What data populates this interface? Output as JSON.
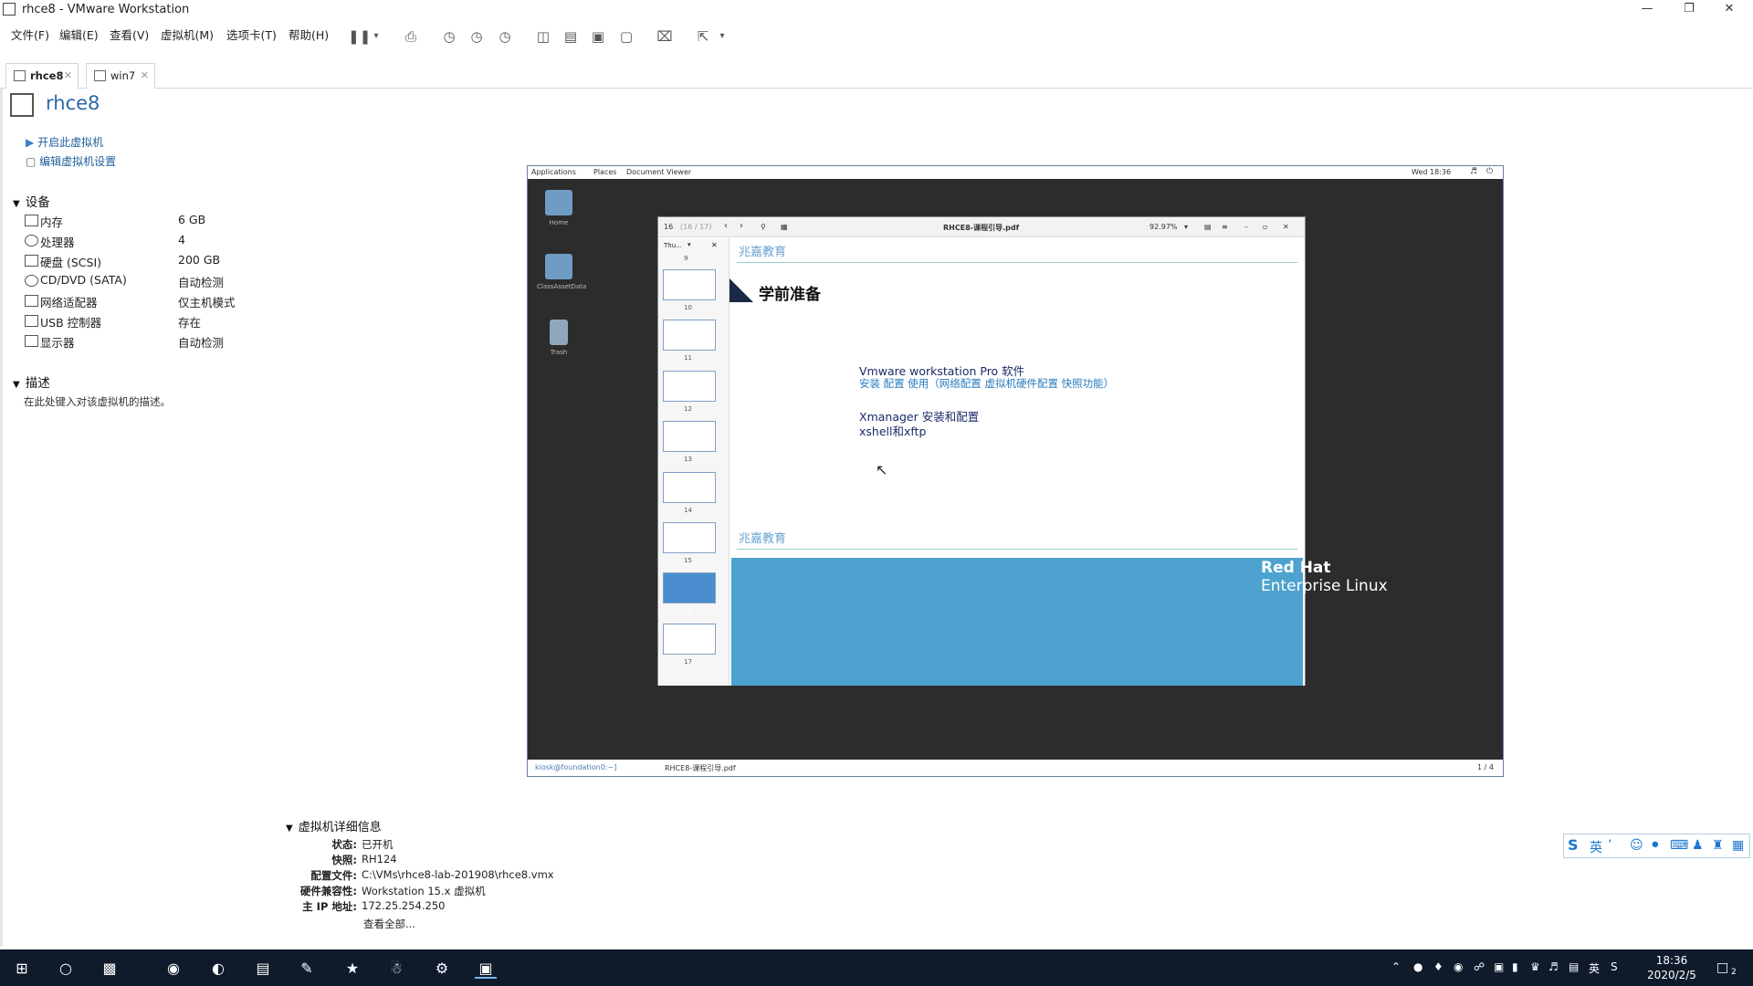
{
  "window": {
    "title": "rhce8 - VMware Workstation"
  },
  "menu": [
    "文件(F)",
    "编辑(E)",
    "查看(V)",
    "虚拟机(M)",
    "选项卡(T)",
    "帮助(H)"
  ],
  "tabs": [
    {
      "label": "rhce8"
    },
    {
      "label": "win7"
    }
  ],
  "vm": {
    "name": "rhce8",
    "actions": {
      "power_on": "开启此虚拟机",
      "edit": "编辑虚拟机设置"
    },
    "devices_header": "设备",
    "devices": [
      {
        "label": "内存",
        "value": "6 GB"
      },
      {
        "label": "处理器",
        "value": "4"
      },
      {
        "label": "硬盘 (SCSI)",
        "value": "200 GB"
      },
      {
        "label": "CD/DVD (SATA)",
        "value": "自动检测"
      },
      {
        "label": "网络适配器",
        "value": "仅主机模式"
      },
      {
        "label": "USB 控制器",
        "value": "存在"
      },
      {
        "label": "显示器",
        "value": "自动检测"
      }
    ],
    "desc_header": "描述",
    "desc_placeholder": "在此处键入对该虚拟机的描述。"
  },
  "guest": {
    "topbar": {
      "applications": "Applications",
      "places": "Places",
      "app": "Document Viewer",
      "clock": "Wed 18:36"
    },
    "desktop_icons": [
      "Home",
      "ClassAssetData",
      "Trash"
    ],
    "pdf": {
      "title": "RHCE8-课程引导.pdf",
      "page_field": "16",
      "page_of": "(16 / 17)",
      "zoom": "92.97%",
      "thumbs_label": "Thu...",
      "thumb_numbers": [
        "9",
        "10",
        "11",
        "12",
        "13",
        "14",
        "15",
        "16",
        "17"
      ],
      "logo_text": "兆嘉教育",
      "heading": "学前准备",
      "line1": "Vmware workstation Pro 软件",
      "line2": "安装 配置 使用（网络配置 虚拟机硬件配置 快照功能）",
      "line3": "Xmanager 安装和配置",
      "line4": "xshell和xftp"
    },
    "brand": {
      "line1": "Red Hat",
      "line2": "Enterprise Linux"
    },
    "taskbar": {
      "item1": "kiosk@foundation0:~]",
      "item2": "RHCE8-课程引导.pdf",
      "pager": "1 / 4"
    }
  },
  "details": {
    "header": "虚拟机详细信息",
    "rows": [
      {
        "label": "状态:",
        "value": "已开机"
      },
      {
        "label": "快照:",
        "value": "RH124"
      },
      {
        "label": "配置文件:",
        "value": "C:\\VMs\\rhce8-lab-201908\\rhce8.vmx"
      },
      {
        "label": "硬件兼容性:",
        "value": "Workstation 15.x 虚拟机"
      },
      {
        "label": "主 IP 地址:",
        "value": "172.25.254.250"
      }
    ],
    "view_all": "查看全部..."
  },
  "ime": {
    "mode": "英"
  },
  "taskbar": {
    "time": "18:36",
    "date": "2020/2/5",
    "ime": "英",
    "notify_count": "2"
  }
}
